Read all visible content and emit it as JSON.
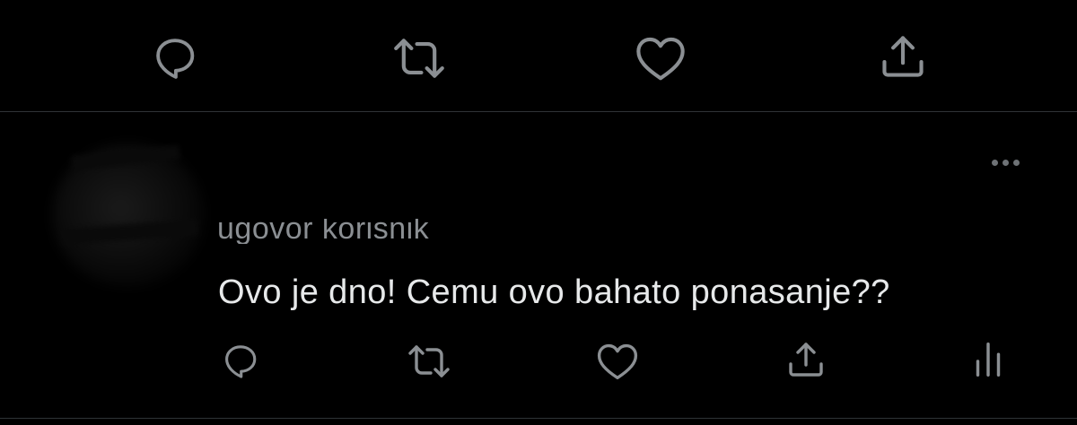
{
  "main_tweet_actions": {
    "reply_icon": "reply-bubble-icon",
    "retweet_icon": "retweet-icon",
    "like_icon": "heart-icon",
    "share_icon": "share-upload-icon"
  },
  "reply": {
    "author_name": "",
    "replying_to_text": "ugovor korisnik",
    "text": "Ovo je dno! Cemu ovo bahato ponasanje??",
    "more_icon": "more-horizontal-icon",
    "actions": {
      "reply_icon": "reply-bubble-icon",
      "retweet_icon": "retweet-icon",
      "like_icon": "heart-icon",
      "share_icon": "share-upload-icon",
      "analytics_icon": "analytics-bars-icon"
    }
  },
  "colors": {
    "background": "#000000",
    "text": "#e7e9ea",
    "icon": "#8b8f93",
    "divider": "#2f3336"
  }
}
